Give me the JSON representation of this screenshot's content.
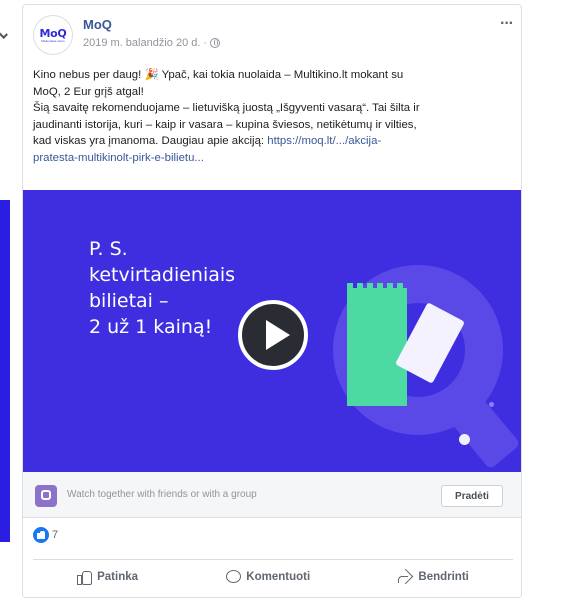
{
  "post": {
    "page_name": "MoQ",
    "avatar_logo": "MoQ",
    "avatar_sub": "Modernaus meno",
    "date": "2019 m. balandžio 20 d.",
    "more": "···",
    "text_lines": [
      "Kino nebus per daug! 🎉 Ypač, kai tokia nuolaida – Multikino.lt mokant su",
      "MoQ, 2 Eur grįš atgal!",
      "Šią savaitę rekomenduojame – lietuvišką juostą „Išgyventi vasarą“. Tai šilta ir",
      "jaudinanti istorija, kuri – kaip ir vasara – kupina šviesos, netikėtumų ir vilties,"
    ],
    "line5_text": "kad viskas yra įmanoma. Daugiau apie akciją: ",
    "link_part1": "https://moq.lt/.../akcija-",
    "link_part2": "pratesta-multikinolt-pirk-e-bilietu...",
    "video_headline": [
      "P. S.",
      "ketvirtadieniais",
      "bilietai –",
      "2 už 1 kainą!"
    ],
    "watch_text": "Watch together with friends or with a group",
    "start_button": "Pradėti",
    "reaction_count": "7",
    "actions": {
      "like": "Patinka",
      "comment": "Komentuoti",
      "share": "Bendrinti"
    }
  },
  "colors": {
    "video_bg": "#3e2ee0",
    "brand_link": "#385898",
    "ticket_green": "#4dd9a2"
  }
}
